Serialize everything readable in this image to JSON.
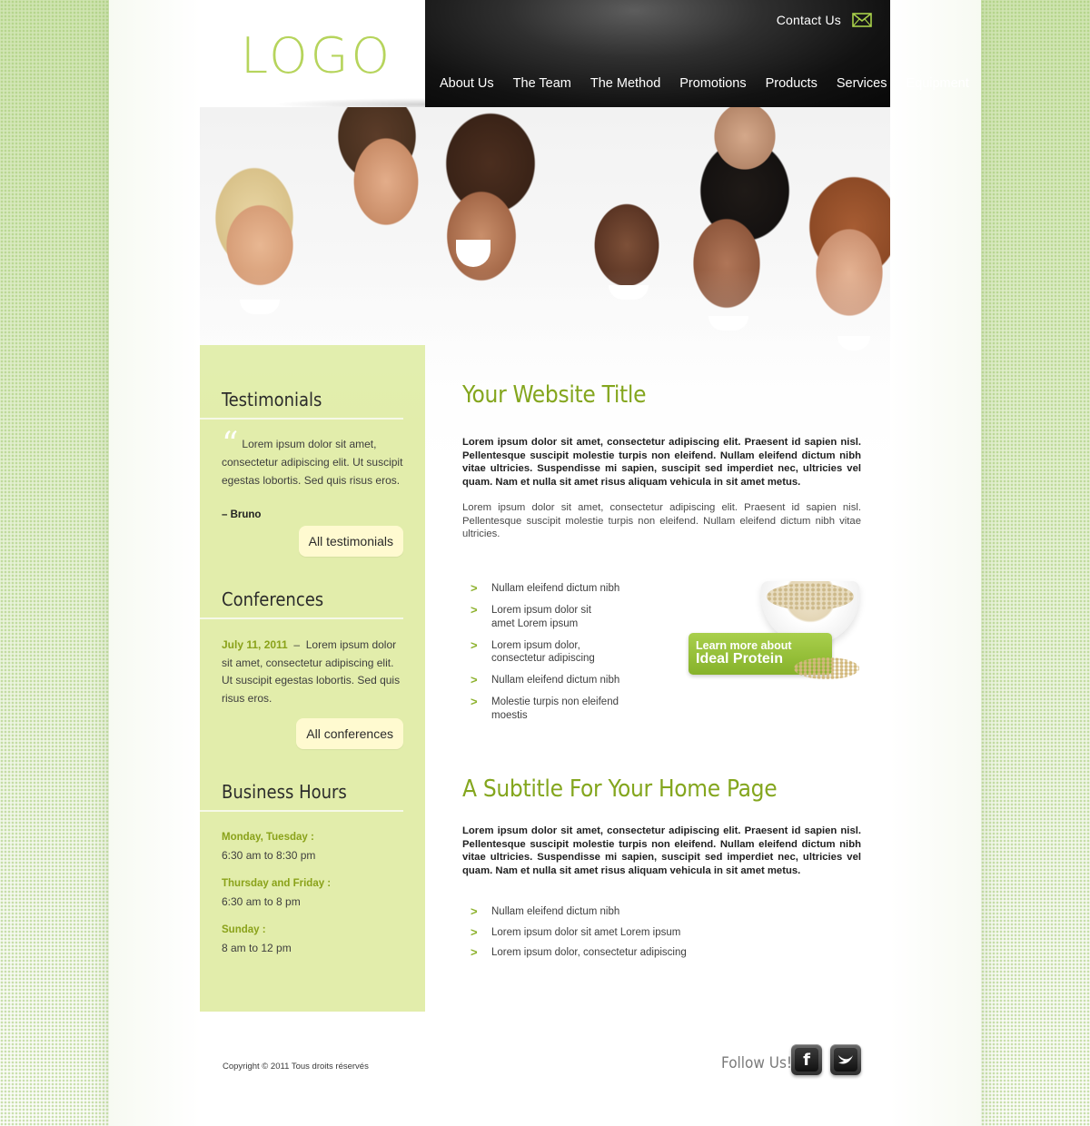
{
  "header": {
    "logo_text": "LOGO",
    "contact_label": "Contact Us",
    "nav": [
      "About Us",
      "The Team",
      "The Method",
      "Promotions",
      "Products",
      "Services",
      "Equipment"
    ]
  },
  "sidebar": {
    "testimonials": {
      "heading": "Testimonials",
      "quote": "Lorem ipsum dolor sit amet, consectetur adipiscing elit. Ut suscipit egestas lobortis. Sed quis risus eros.",
      "author": "– Bruno",
      "button": "All testimonials"
    },
    "conferences": {
      "heading": "Conferences",
      "date": "July 11, 2011",
      "text": "Lorem ipsum dolor sit amet, consectetur adipiscing elit. Ut suscipit egestas lobortis. Sed quis risus eros.",
      "button": "All conferences"
    },
    "hours": {
      "heading": "Business Hours",
      "entries": [
        {
          "days": "Monday, Tuesday :",
          "time": "6:30 am to 8:30 pm"
        },
        {
          "days": "Thursday and Friday :",
          "time": "6:30 am to 8 pm"
        },
        {
          "days": "Sunday :",
          "time": "8 am to 12 pm"
        }
      ]
    }
  },
  "main": {
    "title": "Your Website Title",
    "intro_bold": "Lorem ipsum dolor sit amet, consectetur adipiscing elit. Praesent id sapien nisl. Pellentesque suscipit molestie turpis non eleifend. Nullam eleifend dictum nibh vitae ultricies. Suspendisse mi sapien, suscipit sed imperdiet nec, ultricies vel quam. Nam et nulla sit amet risus aliquam vehicula in sit amet metus.",
    "intro": "Lorem ipsum dolor sit amet, consectetur adipiscing elit. Praesent id sapien nisl. Pellentesque suscipit molestie turpis non eleifend. Nullam eleifend dictum nibh vitae ultricies.",
    "list1": [
      "Nullam eleifend dictum nibh",
      "Lorem ipsum dolor sit amet Lorem ipsum",
      "Lorem ipsum dolor, consectetur adipiscing",
      "Nullam eleifend dictum nibh",
      "Molestie turpis non eleifend moestis"
    ],
    "promo": {
      "line1": "Learn more about",
      "line2": "Ideal Protein"
    },
    "subtitle": "A Subtitle For Your Home Page",
    "sub_bold": "Lorem ipsum dolor sit amet, consectetur adipiscing elit. Praesent id sapien nisl. Pellentesque suscipit molestie turpis non eleifend. Nullam eleifend dictum nibh vitae ultricies. Suspendisse mi sapien, suscipit sed imperdiet nec, ultricies vel quam. Nam et nulla sit amet risus aliquam vehicula in sit amet metus.",
    "list2": [
      "Nullam eleifend dictum nibh",
      "Lorem ipsum dolor sit amet Lorem ipsum",
      "Lorem ipsum dolor, consectetur adipiscing"
    ]
  },
  "footer": {
    "copyright": "Copyright © 2011 Tous droits réservés",
    "follow": "Follow Us!",
    "social_icons": [
      "facebook-icon",
      "twitter-icon"
    ]
  },
  "colors": {
    "accent": "#84a61e",
    "sidebar_bg": "#e2edab",
    "button_bg": "#fffad0",
    "header_bg": "#1a1a1a"
  }
}
